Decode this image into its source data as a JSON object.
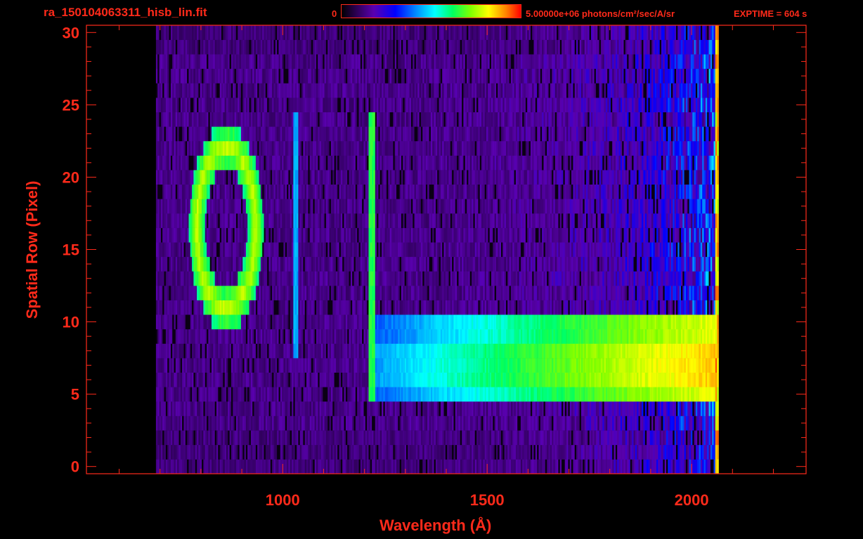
{
  "header": {
    "title": "ra_150104063311_hisb_lin.fit",
    "colorbar_min": "0",
    "colorbar_max": "5.00000e+06 photons/cm²/sec/A/sr",
    "exptime": "EXPTIME = 604 s"
  },
  "colors": {
    "axis": "#ff2a1a",
    "background": "#000000"
  },
  "chart_data": {
    "type": "heatmap",
    "title": "ra_150104063311_hisb_lin.fit",
    "xlabel": "Wavelength (Å)",
    "ylabel": "Spatial Row (Pixel)",
    "xlim": [
      520,
      2280
    ],
    "ylim": [
      -0.5,
      30.5
    ],
    "x_ticks": [
      1000,
      1500,
      2000
    ],
    "y_ticks": [
      0,
      5,
      10,
      15,
      20,
      25,
      30
    ],
    "colorscale": {
      "min": 0,
      "max": 5000000,
      "units": "photons/cm²/sec/A/sr"
    },
    "data_extent": {
      "x": [
        690,
        2065
      ],
      "y": [
        0,
        30
      ]
    },
    "features": [
      {
        "kind": "ring",
        "center_x": 860,
        "center_y": 16.5,
        "radius_x": 85,
        "radius_y": 6.5
      },
      {
        "kind": "vertical_line",
        "x": 1030,
        "y_range": [
          8,
          24
        ]
      },
      {
        "kind": "vertical_line",
        "x": 1216,
        "y_range": [
          5,
          24
        ]
      },
      {
        "kind": "horizontal_band",
        "x_range": [
          1216,
          2060
        ],
        "y_range": [
          5,
          10
        ]
      }
    ]
  }
}
